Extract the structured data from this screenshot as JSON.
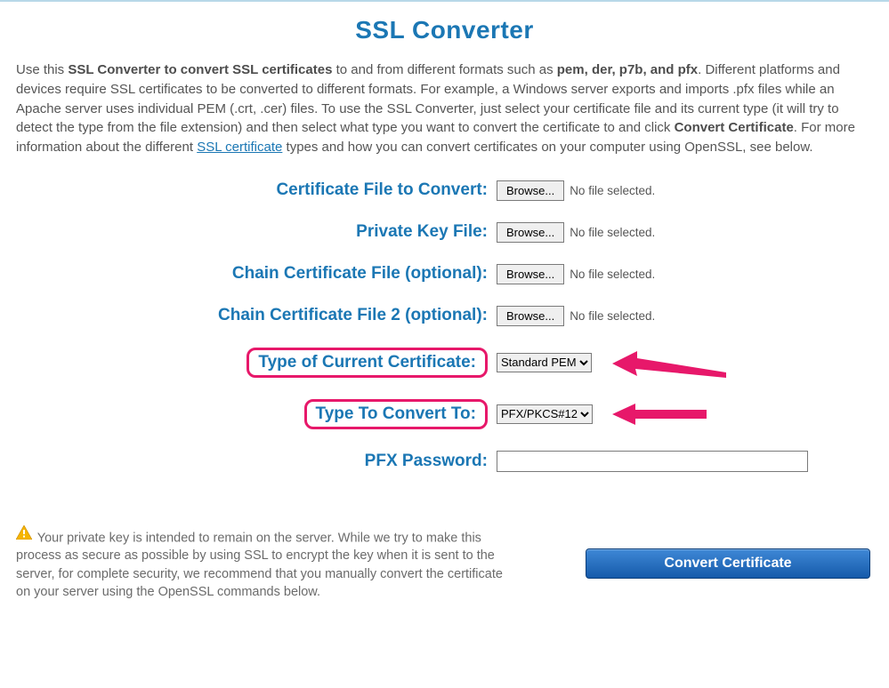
{
  "title": "SSL Converter",
  "intro": {
    "t1": "Use this ",
    "b1": "SSL Converter to convert SSL certificates",
    "t2": " to and from different formats such as ",
    "b2": "pem, der, p7b, and pfx",
    "t3": ". Different platforms and devices require SSL certificates to be converted to different formats. For example, a Windows server exports and imports .pfx files while an Apache server uses individual PEM (.crt, .cer) files. To use the SSL Converter, just select your certificate file and its current type (it will try to detect the type from the file extension) and then select what type you want to convert the certificate to and click ",
    "b3": "Convert Certificate",
    "t4": ". For more information about the different ",
    "link": "SSL certificate",
    "t5": " types and how you can convert certificates on your computer using OpenSSL, see below."
  },
  "labels": {
    "cert_file": "Certificate File to Convert:",
    "priv_key": "Private Key File:",
    "chain1": "Chain Certificate File (optional):",
    "chain2": "Chain Certificate File 2 (optional):",
    "type_current": "Type of Current Certificate:",
    "type_convert": "Type To Convert To:",
    "pfx_pass": "PFX Password:"
  },
  "browse_label": "Browse...",
  "no_file": "No file selected.",
  "select_current": "Standard PEM",
  "select_convert": "PFX/PKCS#12",
  "pfx_value": "",
  "warning_text": " Your private key is intended to remain on the server. While we try to make this process as secure as possible by using SSL to encrypt the key when it is sent to the server, for complete security, we recommend that you manually convert the certificate on your server using the OpenSSL commands below.",
  "convert_button": "Convert Certificate"
}
